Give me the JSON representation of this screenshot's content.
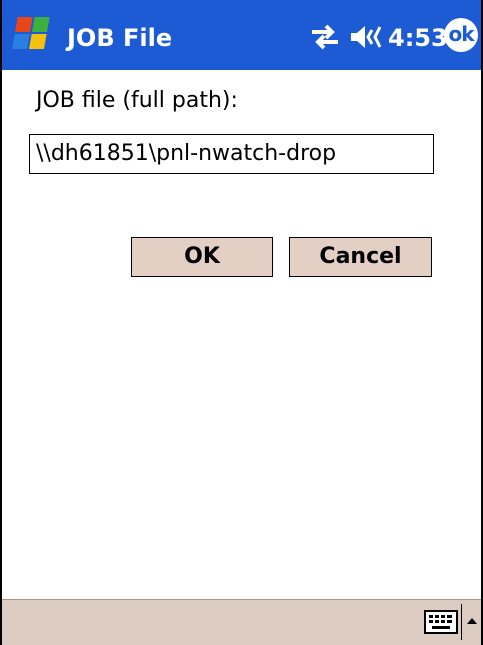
{
  "titlebar": {
    "title": "JOB File",
    "time": "4:53",
    "ok_label": "ok"
  },
  "form": {
    "label": "JOB file (full path):",
    "path_value": "\\\\dh61851\\pnl-nwatch-drop"
  },
  "buttons": {
    "ok_label": "OK",
    "cancel_label": "Cancel"
  },
  "icons": {
    "start": "windows-flag-icon",
    "connectivity": "connectivity-arrows-icon",
    "volume": "speaker-icon",
    "keyboard": "keyboard-icon",
    "sip_toggle": "up-arrow-icon"
  },
  "colors": {
    "titlebar_bg": "#1c5bd3",
    "button_bg": "#e4cfc4",
    "menubar_bg": "#dccbc0"
  }
}
